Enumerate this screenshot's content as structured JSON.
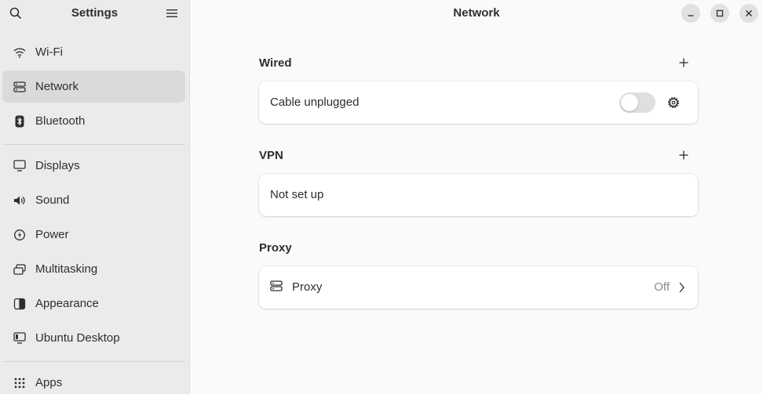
{
  "sidebar": {
    "title": "Settings",
    "search_icon": "search-icon",
    "menu_icon": "hamburger-menu-icon",
    "items": [
      {
        "label": "Wi-Fi",
        "icon": "wifi-icon"
      },
      {
        "label": "Network",
        "icon": "network-icon",
        "active": true
      },
      {
        "label": "Bluetooth",
        "icon": "bluetooth-icon"
      },
      {
        "label": "Displays",
        "icon": "display-icon"
      },
      {
        "label": "Sound",
        "icon": "speaker-icon"
      },
      {
        "label": "Power",
        "icon": "power-icon"
      },
      {
        "label": "Multitasking",
        "icon": "multitasking-icon"
      },
      {
        "label": "Appearance",
        "icon": "appearance-icon"
      },
      {
        "label": "Ubuntu Desktop",
        "icon": "ubuntu-desktop-icon"
      },
      {
        "label": "Apps",
        "icon": "apps-grid-icon"
      }
    ]
  },
  "main": {
    "title": "Network",
    "window_controls": [
      "minimize",
      "maximize",
      "close"
    ],
    "wired": {
      "title": "Wired",
      "status": "Cable unplugged",
      "toggle_on": false
    },
    "vpn": {
      "title": "VPN",
      "status": "Not set up"
    },
    "proxy": {
      "title": "Proxy",
      "label": "Proxy",
      "value": "Off"
    }
  },
  "colors": {
    "sidebar_bg": "#ebebeb",
    "active_item": "#dadada",
    "main_bg": "#fafafa",
    "card_bg": "#ffffff"
  }
}
